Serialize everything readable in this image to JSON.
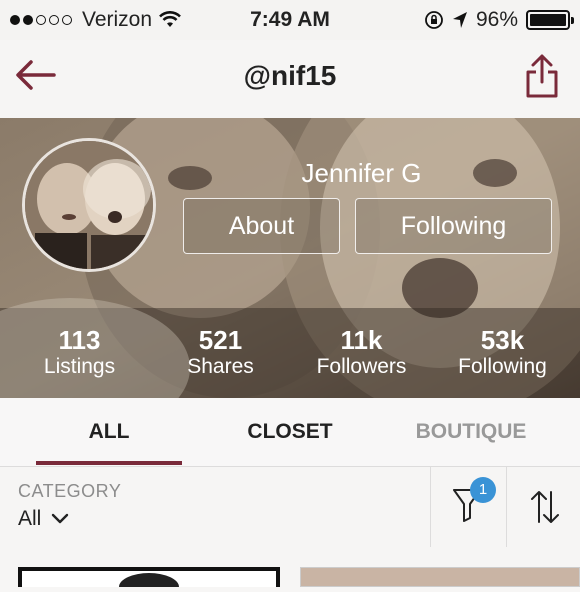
{
  "status_bar": {
    "carrier": "Verizon",
    "time": "7:49 AM",
    "battery": "96%",
    "battery_level": 0.96,
    "signal_bars_filled": 2,
    "signal_bars_total": 5
  },
  "nav": {
    "title": "@nif15",
    "back_icon": "back-arrow-icon",
    "share_icon": "share-icon",
    "accent_color": "#7a2a3a"
  },
  "profile": {
    "name": "Jennifer G",
    "about_label": "About",
    "following_button_label": "Following",
    "stats": [
      {
        "value": "113",
        "label": "Listings"
      },
      {
        "value": "521",
        "label": "Shares"
      },
      {
        "value": "11k",
        "label": "Followers"
      },
      {
        "value": "53k",
        "label": "Following"
      }
    ]
  },
  "tabs": [
    {
      "label": "ALL",
      "active": true
    },
    {
      "label": "CLOSET",
      "active": false
    },
    {
      "label": "BOUTIQUE",
      "active": false
    }
  ],
  "filter": {
    "category_label": "CATEGORY",
    "category_value": "All",
    "filter_badge_count": "1",
    "filter_icon": "filter-funnel-icon",
    "sort_icon": "sort-arrows-icon",
    "badge_color": "#3a93d6"
  }
}
